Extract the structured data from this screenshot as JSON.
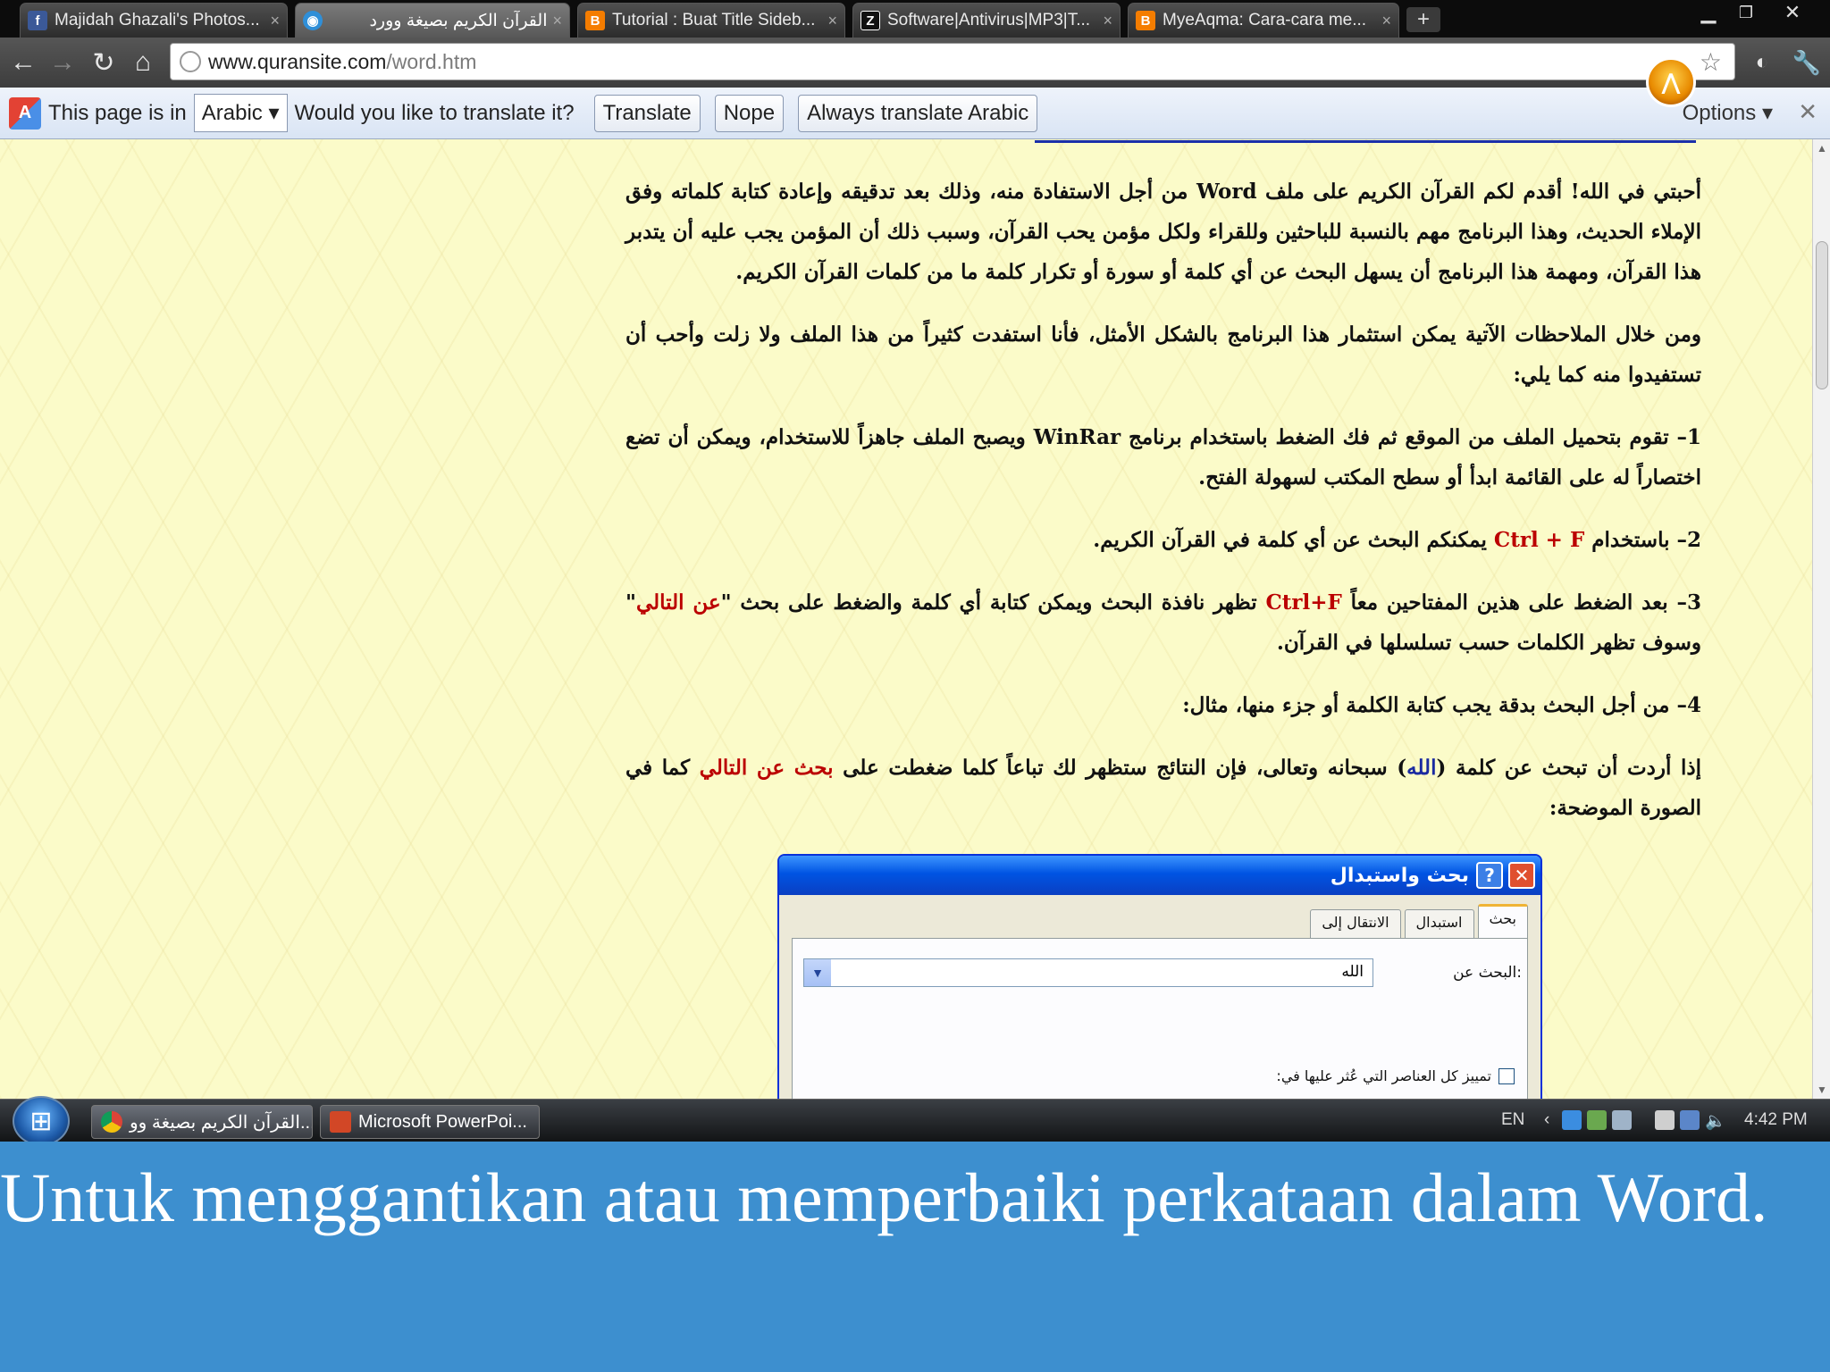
{
  "browser": {
    "tabs": [
      {
        "label": "Majidah Ghazali's Photos...",
        "favicon": "facebook-icon",
        "color": "#3b5998",
        "glyph": "f"
      },
      {
        "label": "القرآن الكريم بصيغة وورد",
        "favicon": "globe-icon",
        "color": "#2f8fd8",
        "glyph": "◉"
      },
      {
        "label": "Tutorial : Buat Title Sideb...",
        "favicon": "blogger-icon",
        "color": "#f57d00",
        "glyph": "B"
      },
      {
        "label": "Software|Antivirus|MP3|T...",
        "favicon": "z-icon",
        "color": "#111111",
        "glyph": "Z"
      },
      {
        "label": "MyeAqma: Cara-cara me...",
        "favicon": "blogger-icon",
        "color": "#f57d00",
        "glyph": "B"
      }
    ],
    "url_host": "www.quransite.com",
    "url_path": "/word.htm"
  },
  "translate_bar": {
    "prefix": "This page is in",
    "language": "Arabic",
    "question": "Would you like to translate it?",
    "translate_button": "Translate",
    "nope_button": "Nope",
    "always_button": "Always translate Arabic",
    "options": "Options"
  },
  "article": {
    "p1": "أحبتي في الله! أقدم لكم القرآن الكريم على ملف Word من أجل الاستفادة منه، وذلك بعد تدقيقه وإعادة كتابة كلماته وفق الإملاء الحديث، وهذا البرنامج مهم بالنسبة للباحثين وللقراء ولكل مؤمن يحب القرآن، وسبب ذلك أن المؤمن يجب عليه أن يتدبر هذا القرآن، ومهمة هذا البرنامج أن يسهل البحث عن أي كلمة أو سورة أو تكرار كلمة ما من كلمات القرآن الكريم.",
    "p2": "ومن خلال الملاحظات الآتية يمكن استثمار هذا البرنامج بالشكل الأمثل، فأنا استفدت كثيراً من هذا الملف ولا زلت وأحب أن تستفيدوا منه كما يلي:",
    "p3": "1– تقوم بتحميل الملف من الموقع ثم فك الضغط باستخدام برنامج WinRar ويصبح الملف جاهزاً للاستخدام، ويمكن أن تضع اختصاراً له على القائمة ابدأ أو سطح المكتب لسهولة الفتح.",
    "p4_a": "2– باستخدام ",
    "p4_key": "Ctrl + F",
    "p4_b": " يمكنكم البحث عن أي كلمة في القرآن الكريم.",
    "p5_a": "3– بعد الضغط على هذين المفتاحين معاً ",
    "p5_key": "Ctrl+F",
    "p5_b": " تظهر نافذة البحث ويمكن كتابة أي كلمة والضغط على بحث \"",
    "p5_next": "عن التالي",
    "p5_c": "\" وسوف تظهر الكلمات حسب تسلسلها في القرآن.",
    "p6": "4– من أجل البحث بدقة يجب كتابة الكلمة أو جزء منها، مثال:",
    "p7_a": "إذا أردت أن تبحث  عن كلمة (",
    "p7_word": "الله",
    "p7_b": ") سبحانه وتعالى، فإن النتائج ستظهر لك تباعاً كلما ضغطت على ",
    "p7_btn": "بحث عن التالي",
    "p7_c": " كما في الصورة الموضحة:"
  },
  "dialog": {
    "title": "بحث واستبدال",
    "tabs": [
      "بحث",
      "استبدال",
      "الانتقال إلى"
    ],
    "find_label": "البحث عن:",
    "find_value": "الله",
    "highlight_label": "تمييز كل العناصر التي عُثر عليها في:"
  },
  "taskbar": {
    "tasks": [
      "القرآن الكريم بصيغة وو...",
      "Microsoft PowerPoi..."
    ],
    "lang": "EN",
    "time": "4:42 PM"
  },
  "caption": "Untuk menggantikan atau memperbaiki perkataan dalam Word.",
  "colors": {
    "accent_red": "#bb0000",
    "accent_blue": "#1a2aa0",
    "page_bg": "#fbfbc9",
    "caption_bg": "#3d8fcf"
  }
}
